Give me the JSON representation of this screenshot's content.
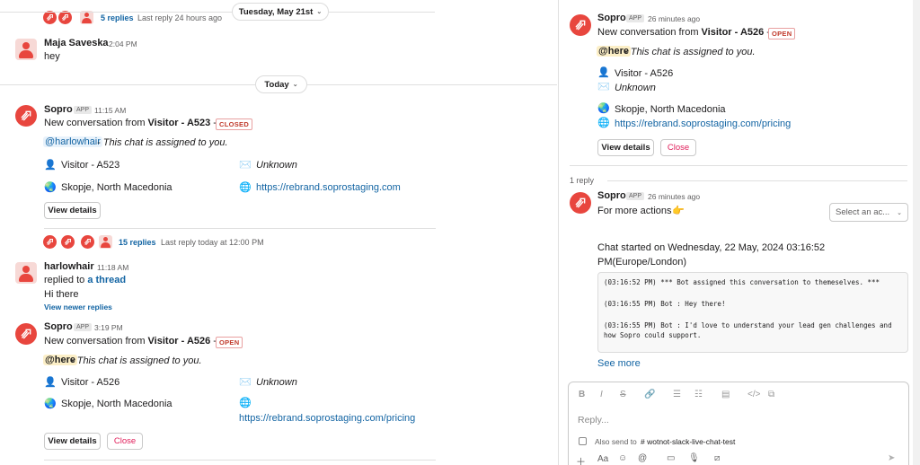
{
  "main": {
    "top_thread": {
      "replies": "5 replies",
      "last_reply": "Last reply 24 hours ago"
    },
    "date_divider_1": "Tuesday, May 21st",
    "msg_maja": {
      "name": "Maja Saveska",
      "time": "2:04 PM",
      "text": "hey"
    },
    "date_divider_2": "Today",
    "msg_sopro_1": {
      "name": "Sopro",
      "badge": "APP",
      "time": "11:15 AM",
      "text_prefix": "New conversation from ",
      "visitor": "Visitor - A523",
      "dash": " -",
      "status": "CLOSED",
      "mention": "@harlowhair",
      "assigned": " - This chat is assigned to you.",
      "visitor_line": "Visitor - A523",
      "email": "Unknown",
      "location": "Skopje, North Macedonia",
      "url": "https://rebrand.soprostaging.com",
      "button": "View details"
    },
    "thread_summary_2": {
      "replies": "15 replies",
      "last_reply": "Last reply today at 12:00 PM"
    },
    "msg_harlow": {
      "name": "harlowhair",
      "time": "11:18 AM",
      "replied_prefix": "replied to ",
      "replied_link": "a thread",
      "text": "Hi there",
      "view_newer": "View newer replies"
    },
    "msg_sopro_2": {
      "name": "Sopro",
      "badge": "APP",
      "time": "3:19 PM",
      "text_prefix": "New conversation from ",
      "visitor": "Visitor - A526",
      "dash": " -",
      "status": "OPEN",
      "mention": "@here",
      "assigned": " - This chat is assigned to you.",
      "visitor_line": "Visitor - A526",
      "email": "Unknown",
      "location": "Skopje, North Macedonia",
      "url": "https://rebrand.soprostaging.com/pricing",
      "button_details": "View details",
      "button_close": "Close"
    }
  },
  "thread": {
    "parent": {
      "name": "Sopro",
      "badge": "APP",
      "time": "26 minutes ago",
      "text_prefix": "New conversation from ",
      "visitor": "Visitor - A526",
      "dash": " -",
      "status": "OPEN",
      "mention": "@here",
      "assigned": " - This chat is assigned to you.",
      "visitor_line": "Visitor - A526",
      "email": "Unknown",
      "location": "Skopje, North Macedonia",
      "url": "https://rebrand.soprostaging.com/pricing",
      "button_details": "View details",
      "button_close": "Close"
    },
    "reply_count": "1 reply",
    "reply": {
      "name": "Sopro",
      "badge": "APP",
      "time": "26 minutes ago",
      "text": "For more actions",
      "select_placeholder": "Select an ac...",
      "chat_started_1": "Chat started on Wednesday, 22 May, 2024 03:16:52",
      "chat_started_2": "PM(Europe/London)",
      "log": [
        "(03:16:52 PM) *** Bot assigned this conversation to themeselves. ***",
        "(03:16:55 PM) Bot : Hey there!",
        "(03:16:55 PM) Bot : I'd love to understand your lead gen challenges and how Sopro could support."
      ],
      "see_more": "See more"
    },
    "composer": {
      "placeholder": "Reply...",
      "also_send": "Also send to",
      "channel": "# wotnot-slack-live-chat-test"
    }
  },
  "icons": {
    "visitor": "bust-in-silhouette-icon",
    "email": "envelope-icon",
    "location": "globe-icon",
    "url": "globe-with-meridians-icon",
    "point": "backhand-index-pointing-right-icon"
  },
  "colors": {
    "brand": "#e8463e",
    "link": "#1264a3",
    "danger": "#e01e5a",
    "here_highlight": "#fcefc7"
  }
}
